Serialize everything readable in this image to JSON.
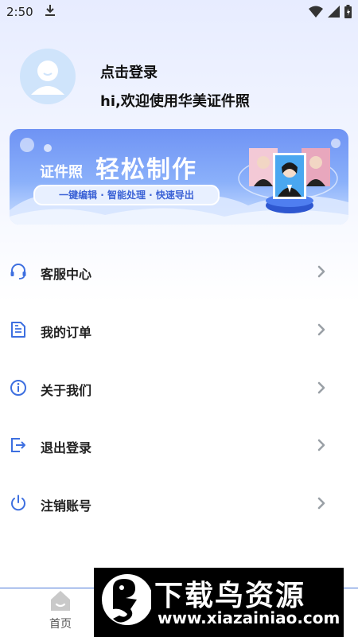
{
  "status_bar": {
    "time": "2:50",
    "download_icon": "download-icon",
    "wifi_icon": "wifi-icon",
    "signal_icon": "signal-icon",
    "battery_icon": "battery-icon"
  },
  "profile": {
    "avatar_icon": "user-avatar-icon",
    "login_label": "点击登录",
    "welcome_text": "hi,欢迎使用华美证件照"
  },
  "banner": {
    "tag": "证件照",
    "headline": "轻松制作",
    "features": "一键编辑 · 智能处理 · 快速导出",
    "colors": {
      "top": "#6f93f4",
      "bottom": "#cfe2ff"
    }
  },
  "menu": {
    "items": [
      {
        "label": "客服中心",
        "icon": "headset-icon"
      },
      {
        "label": "我的订单",
        "icon": "document-icon"
      },
      {
        "label": "关于我们",
        "icon": "info-icon"
      },
      {
        "label": "退出登录",
        "icon": "logout-icon"
      },
      {
        "label": "注销账号",
        "icon": "power-icon"
      }
    ],
    "chevron_icon": "chevron-right-icon",
    "icon_color": "#3d6fe0"
  },
  "bottom_nav": {
    "home_label": "首页",
    "home_icon": "home-icon"
  },
  "watermark": {
    "title": "下载鸟资源",
    "url": "www.xiazainiao.com"
  }
}
